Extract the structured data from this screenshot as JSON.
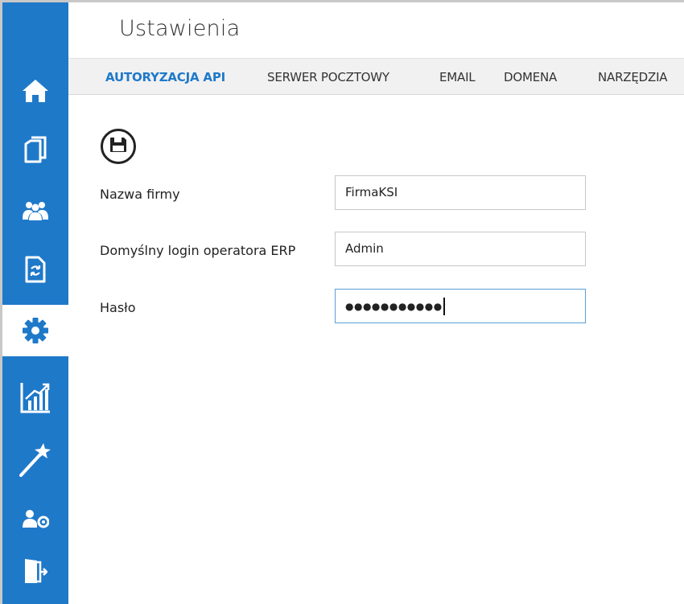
{
  "app": {
    "title": "Ustawienia"
  },
  "tabs": [
    {
      "label": "AUTORYZACJA API",
      "active": true
    },
    {
      "label": "SERWER POCZTOWY",
      "active": false
    },
    {
      "label": "EMAIL",
      "active": false
    },
    {
      "label": "DOMENA",
      "active": false
    },
    {
      "label": "NARZĘDZIA",
      "active": false
    }
  ],
  "sidebar": {
    "items": [
      {
        "icon": "home-icon",
        "active": false
      },
      {
        "icon": "documents-icon",
        "active": false
      },
      {
        "icon": "users-icon",
        "active": false
      },
      {
        "icon": "sync-document-icon",
        "active": false
      },
      {
        "icon": "gear-icon",
        "active": true
      },
      {
        "icon": "chart-icon",
        "active": false
      },
      {
        "icon": "magic-wand-icon",
        "active": false
      },
      {
        "icon": "user-settings-icon",
        "active": false
      },
      {
        "icon": "logout-icon",
        "active": false
      }
    ]
  },
  "toolbar": {
    "save_icon": "floppy-disk-icon"
  },
  "form": {
    "company_name": {
      "label": "Nazwa firmy",
      "value": "FirmaKSI"
    },
    "erp_login": {
      "label": "Domyślny login operatora ERP",
      "value": "Admin"
    },
    "password": {
      "label": "Hasło",
      "value": "●●●●●●●●●●●",
      "focused": true
    }
  },
  "colors": {
    "accent": "#1f79c9",
    "tab_bar": "#f1f1f1",
    "sidebar_active": "#ffffff",
    "icon_white": "#ffffff",
    "icon_active": "#1f79c9"
  }
}
